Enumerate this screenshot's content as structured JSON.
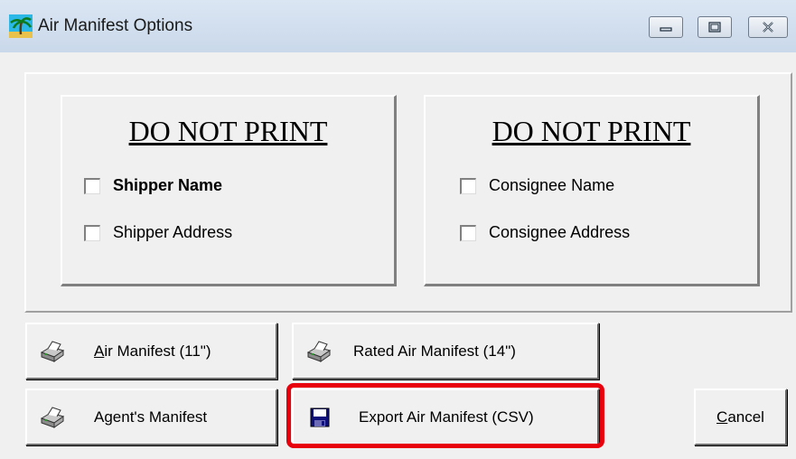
{
  "window": {
    "title": "Air Manifest Options",
    "icon": "palm-tree-icon",
    "controls": [
      "minimize-icon",
      "maximize-icon",
      "close-icon"
    ]
  },
  "groups": [
    {
      "title": "DO NOT PRINT",
      "options": [
        {
          "label": "Shipper Name",
          "checked": false
        },
        {
          "label": "Shipper Address",
          "checked": false
        }
      ]
    },
    {
      "title": "DO NOT PRINT",
      "options": [
        {
          "label": "Consignee Name",
          "checked": false
        },
        {
          "label": "Consignee Address",
          "checked": false
        }
      ]
    }
  ],
  "buttons": {
    "air_manifest": {
      "label_mnemonic": "A",
      "label_rest": "ir Manifest (11\")",
      "icon": "printer-icon"
    },
    "rated_air_manifest": {
      "label": "Rated Air Manifest (14\")",
      "icon": "printer-icon"
    },
    "agents_manifest": {
      "label": "Agent's Manifest",
      "icon": "printer-icon"
    },
    "export_air_manifest": {
      "label": "Export Air Manifest (CSV)",
      "icon": "floppy-disk-icon"
    },
    "cancel": {
      "label_mnemonic": "C",
      "label_rest": "ancel"
    }
  },
  "highlight_color": "#e8000c"
}
